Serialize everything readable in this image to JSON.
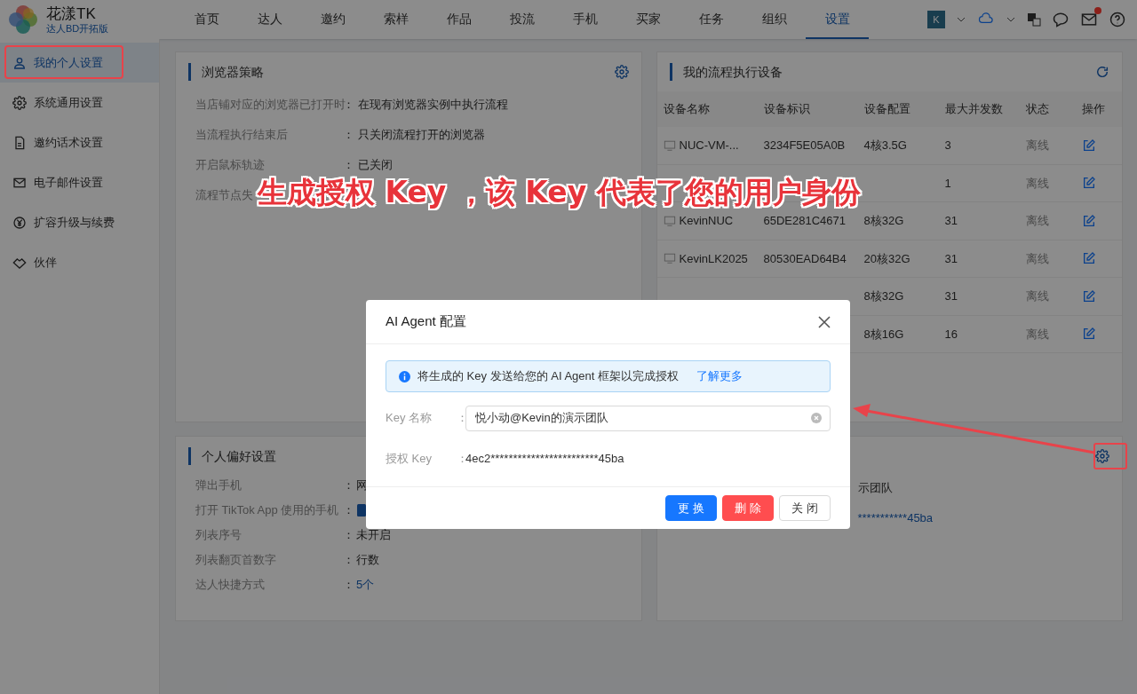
{
  "brand": {
    "name": "花漾TK",
    "edition": "达人BD开拓版"
  },
  "nav": [
    {
      "label": "首页",
      "selected": false
    },
    {
      "label": "达人",
      "selected": false
    },
    {
      "label": "邀约",
      "selected": false
    },
    {
      "label": "索样",
      "selected": false
    },
    {
      "label": "作品",
      "selected": false
    },
    {
      "label": "投流",
      "selected": false
    },
    {
      "label": "手机",
      "selected": false
    },
    {
      "label": "买家",
      "selected": false
    },
    {
      "label": "任务",
      "selected": false
    },
    {
      "label": "组织",
      "selected": false
    },
    {
      "label": "设置",
      "selected": true
    }
  ],
  "header": {
    "avatar": "K",
    "mail_unread": true
  },
  "sidebar": {
    "items": [
      {
        "label": "我的个人设置",
        "selected": true
      },
      {
        "label": "系统通用设置",
        "selected": false
      },
      {
        "label": "邀约话术设置",
        "selected": false
      },
      {
        "label": "电子邮件设置",
        "selected": false
      },
      {
        "label": "扩容升级与续费",
        "selected": false
      },
      {
        "label": "伙伴",
        "selected": false
      }
    ]
  },
  "browser_policy": {
    "title": "浏览器策略",
    "rows": [
      {
        "label": "当店铺对应的浏览器已打开时",
        "sep": "：",
        "value": "在现有浏览器实例中执行流程"
      },
      {
        "label": "当流程执行结束后",
        "sep": "：",
        "value": "只关闭流程打开的浏览器"
      },
      {
        "label": "开启鼠标轨迹",
        "sep": "：",
        "value": "已关闭"
      },
      {
        "label": "流程节点失"
      }
    ]
  },
  "devices": {
    "title": "我的流程执行设备",
    "columns": [
      "设备名称",
      "设备标识",
      "设备配置",
      "最大并发数",
      "状态",
      "操作"
    ],
    "rows": [
      {
        "name": "NUC-VM-...",
        "id": "3234F5E05A0B",
        "config": "4核3.5G",
        "max": "3",
        "status": "离线"
      },
      {
        "max": "1",
        "status": "离线"
      },
      {
        "name": "KevinNUC",
        "id": "65DE281C4671",
        "config": "8核32G",
        "max": "31",
        "status": "离线"
      },
      {
        "name": "KevinLK2025",
        "id": "80530EAD64B4",
        "config": "20核32G",
        "max": "31",
        "status": "离线"
      },
      {
        "config": "8核32G",
        "max": "31",
        "status": "离线"
      },
      {
        "config": "8核16G",
        "max": "16",
        "status": "离线"
      }
    ]
  },
  "preferences": {
    "title": "个人偏好设置",
    "rows": [
      {
        "label": "弹出手机",
        "sep": "：",
        "value": "网"
      },
      {
        "label": "打开 TikTok App 使用的手机",
        "sep": "：",
        "kind": "icon"
      },
      {
        "label": "列表序号",
        "sep": "：",
        "value": "未开启"
      },
      {
        "label": "列表翻页首数字",
        "sep": "：",
        "value": "行数"
      },
      {
        "label": "达人快捷方式",
        "sep": "：",
        "value": "5个",
        "kind": "link"
      }
    ]
  },
  "ai_agent_panel": {
    "team": "示团队",
    "key": "***********45ba"
  },
  "dialog": {
    "title": "AI Agent 配置",
    "notice": "将生成的 Key 发送给您的 AI Agent 框架以完成授权",
    "notice_link": "了解更多",
    "key_name_label": "Key 名称",
    "key_name_sep": "：",
    "key_name_value": "悦小动@Kevin的演示团队",
    "auth_key_label": "授权 Key",
    "auth_key_sep": "：",
    "auth_key_value": "4ec2************************45ba",
    "buttons": [
      {
        "label": "更 换",
        "kind": "primary"
      },
      {
        "label": "删 除",
        "kind": "danger"
      },
      {
        "label": "关 闭",
        "kind": "default"
      }
    ]
  },
  "annotation": {
    "caption": "生成授权 Key ，该 Key 代表了您的用户身份"
  }
}
